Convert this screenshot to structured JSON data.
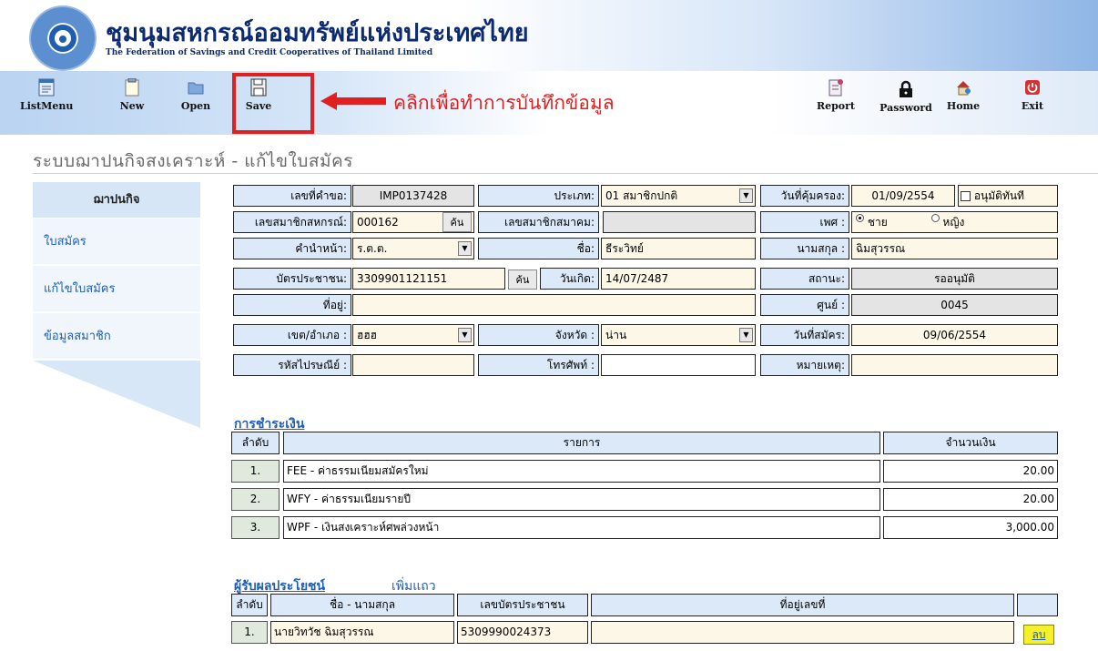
{
  "header": {
    "org_name_th": "ชุมนุมสหกรณ์ออมทรัพย์แห่งประเทศไทย",
    "org_name_en": "The Federation of Savings and Credit Cooperatives of Thailand Limited"
  },
  "toolbar": {
    "listmenu": "ListMenu",
    "new": "New",
    "open": "Open",
    "save": "Save",
    "report": "Report",
    "password": "Password",
    "home": "Home",
    "exit": "Exit"
  },
  "annotation": {
    "text": "คลิกเพื่อทำการบันทึกข้อมูล",
    "color": "#e02020"
  },
  "page": {
    "title": "ระบบฌาปนกิจสงเคราะห์  -  แก้ไขใบสมัคร"
  },
  "sidebar": {
    "header": "ฌาปนกิจ",
    "items": [
      {
        "label": "ใบสมัคร"
      },
      {
        "label": "แก้ไขใบสมัคร"
      },
      {
        "label": "ข้อมูลสมาชิก"
      }
    ]
  },
  "form": {
    "request_no": {
      "label": "เลขที่คำขอ:",
      "value": "IMP0137428"
    },
    "type": {
      "label": "ประเภท:",
      "value": "01 สมาชิกปกติ"
    },
    "coverage_date": {
      "label": "วันที่คุ้มครอง:",
      "value": "01/09/2554"
    },
    "approve_now": {
      "label": "อนุมัติทันที",
      "checked": false
    },
    "coop_member_no": {
      "label": "เลขสมาชิกสหกรณ์:",
      "value": "000162",
      "button": "ค้น"
    },
    "assoc_member_no": {
      "label": "เลขสมาชิกสมาคม:",
      "value": ""
    },
    "gender": {
      "label": "เพศ :",
      "options": [
        "ชาย",
        "หญิง"
      ],
      "selected": "ชาย"
    },
    "prefix": {
      "label": "คำนำหน้า:",
      "value": "ร.ต.ต."
    },
    "first_name": {
      "label": "ชื่อ:",
      "value": "ธีระวิทย์"
    },
    "last_name": {
      "label": "นามสกุล :",
      "value": "ฉิมสุวรรณ"
    },
    "id_card": {
      "label": "บัตรประชาชน:",
      "value": "3309901121151",
      "button": "ค้น"
    },
    "birth_date": {
      "label": "วันเกิด:",
      "value": "14/07/2487"
    },
    "status": {
      "label": "สถานะ:",
      "value": "รออนุมัติ"
    },
    "address": {
      "label": "ที่อยู่:",
      "value": ""
    },
    "center": {
      "label": "ศูนย์ :",
      "value": "0045"
    },
    "district": {
      "label": "เขต/อำเภอ :",
      "value": "ฮฮฮ"
    },
    "province": {
      "label": "จังหวัด :",
      "value": "น่าน"
    },
    "apply_date": {
      "label": "วันที่สมัคร:",
      "value": "09/06/2554"
    },
    "postcode": {
      "label": "รหัสไปรษณีย์ :",
      "value": ""
    },
    "phone": {
      "label": "โทรศัพท์ :",
      "value": ""
    },
    "remark": {
      "label": "หมายเหตุ:",
      "value": ""
    }
  },
  "payment": {
    "title": "การชำระเงิน",
    "columns": [
      "ลำดับ",
      "รายการ",
      "จำนวนเงิน"
    ],
    "rows": [
      {
        "no": "1.",
        "item": "FEE - ค่าธรรมเนียมสมัครใหม่",
        "amount": "20.00"
      },
      {
        "no": "2.",
        "item": "WFY - ค่าธรรมเนียมรายปี",
        "amount": "20.00"
      },
      {
        "no": "3.",
        "item": "WPF - เงินสงเคราะห์ศพล่วงหน้า",
        "amount": "3,000.00"
      }
    ]
  },
  "beneficiaries": {
    "title": "ผู้รับผลประโยชน์",
    "add_row": "เพิ่มแถว",
    "columns": [
      "ลำดับ",
      "ชื่อ - นามสกุล",
      "เลขบัตรประชาชน",
      "ที่อยู่เลขที่",
      ""
    ],
    "rows": [
      {
        "no": "1.",
        "name": "นายวิทวัช  ฉิมสุวรรณ",
        "id_card": "5309990024373",
        "address": "",
        "action": "ลบ"
      }
    ]
  }
}
